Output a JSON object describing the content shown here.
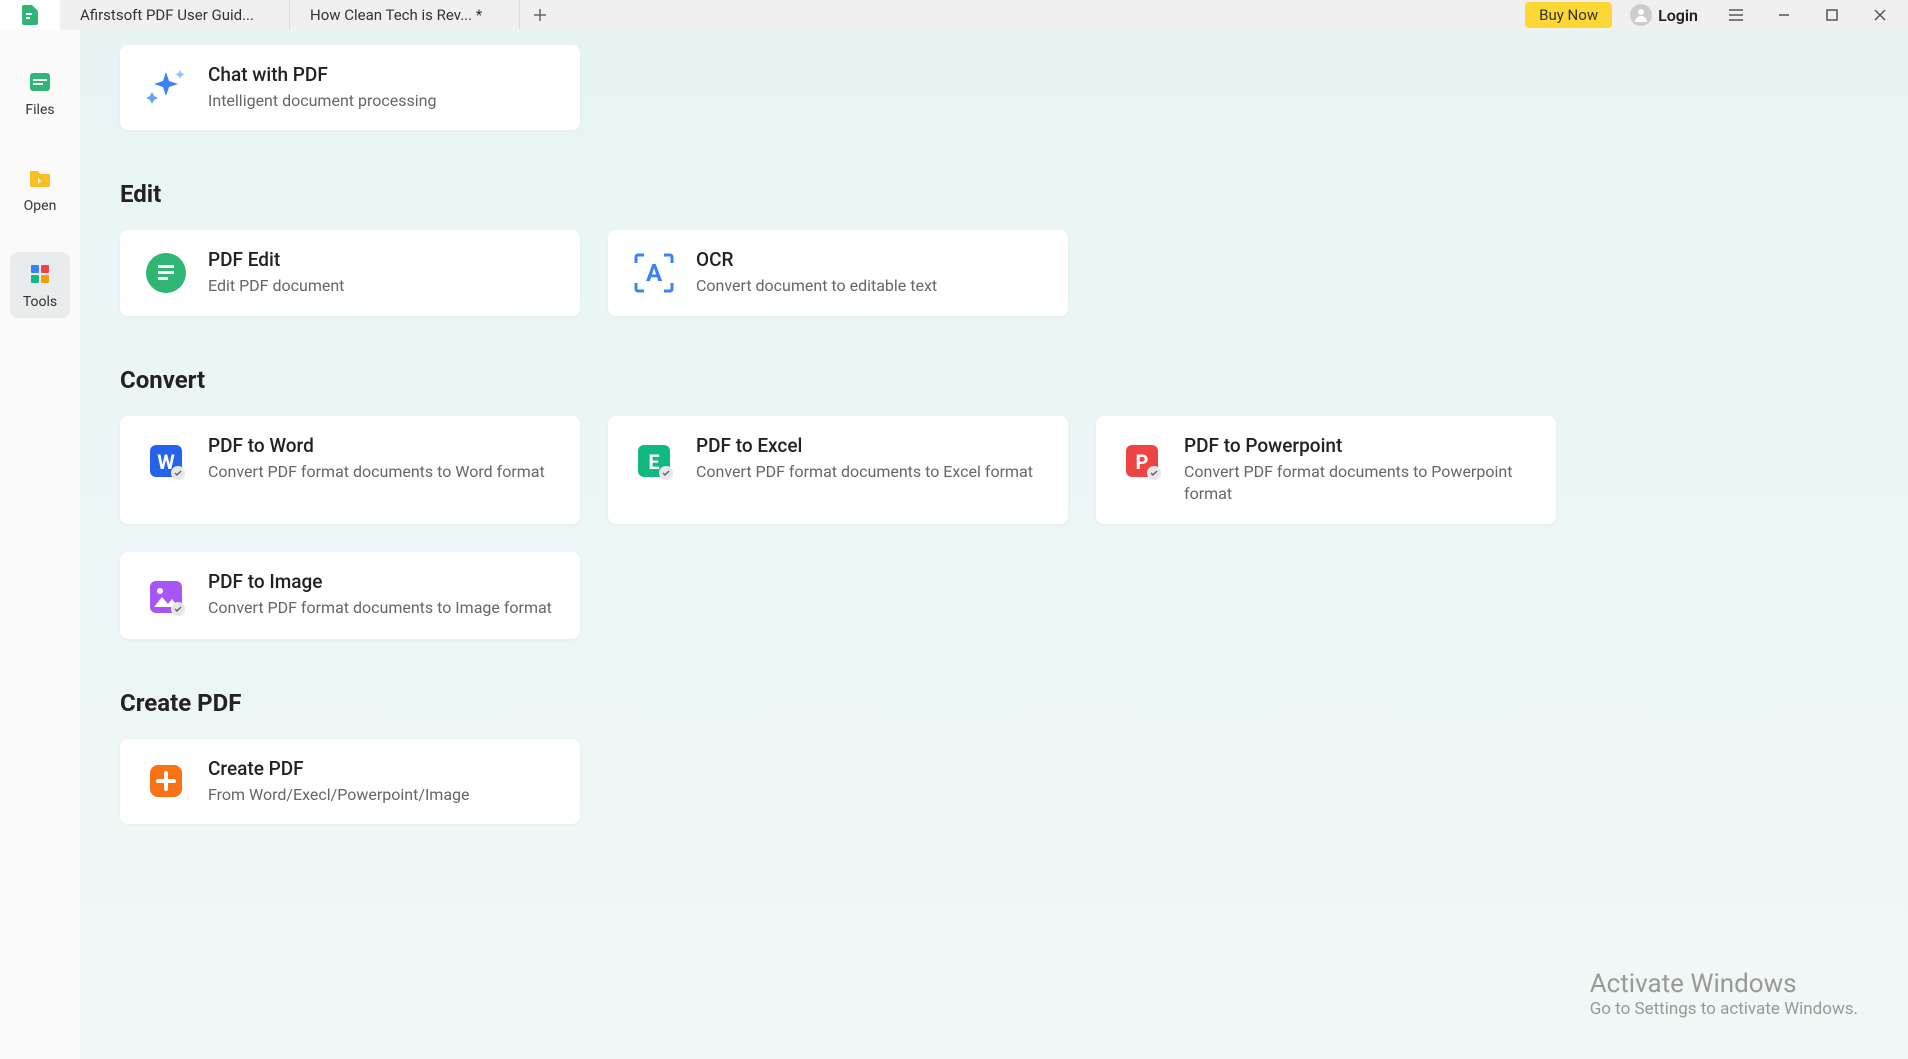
{
  "titlebar": {
    "tabs": [
      "Afirstsoft PDF User Guid...",
      "How Clean Tech is Rev... *"
    ],
    "buy_now": "Buy Now",
    "login": "Login"
  },
  "sidebar": {
    "files": "Files",
    "open": "Open",
    "tools": "Tools"
  },
  "sections": {
    "chat_pdf": {
      "title": "Chat with PDF",
      "desc": "Intelligent document processing"
    },
    "edit_heading": "Edit",
    "pdf_edit": {
      "title": "PDF Edit",
      "desc": "Edit PDF document"
    },
    "ocr": {
      "title": "OCR",
      "desc": "Convert document to editable text"
    },
    "convert_heading": "Convert",
    "pdf_to_word": {
      "title": "PDF to Word",
      "desc": "Convert PDF format documents to Word format"
    },
    "pdf_to_excel": {
      "title": "PDF to Excel",
      "desc": "Convert PDF format documents to Excel format"
    },
    "pdf_to_ppt": {
      "title": "PDF to Powerpoint",
      "desc": "Convert PDF format documents to Powerpoint format"
    },
    "pdf_to_image": {
      "title": "PDF to Image",
      "desc": "Convert PDF format documents to Image format"
    },
    "create_heading": "Create PDF",
    "create_pdf": {
      "title": "Create PDF",
      "desc": "From Word/Execl/Powerpoint/Image"
    }
  },
  "watermark": {
    "title": "Activate Windows",
    "sub": "Go to Settings to activate Windows."
  }
}
